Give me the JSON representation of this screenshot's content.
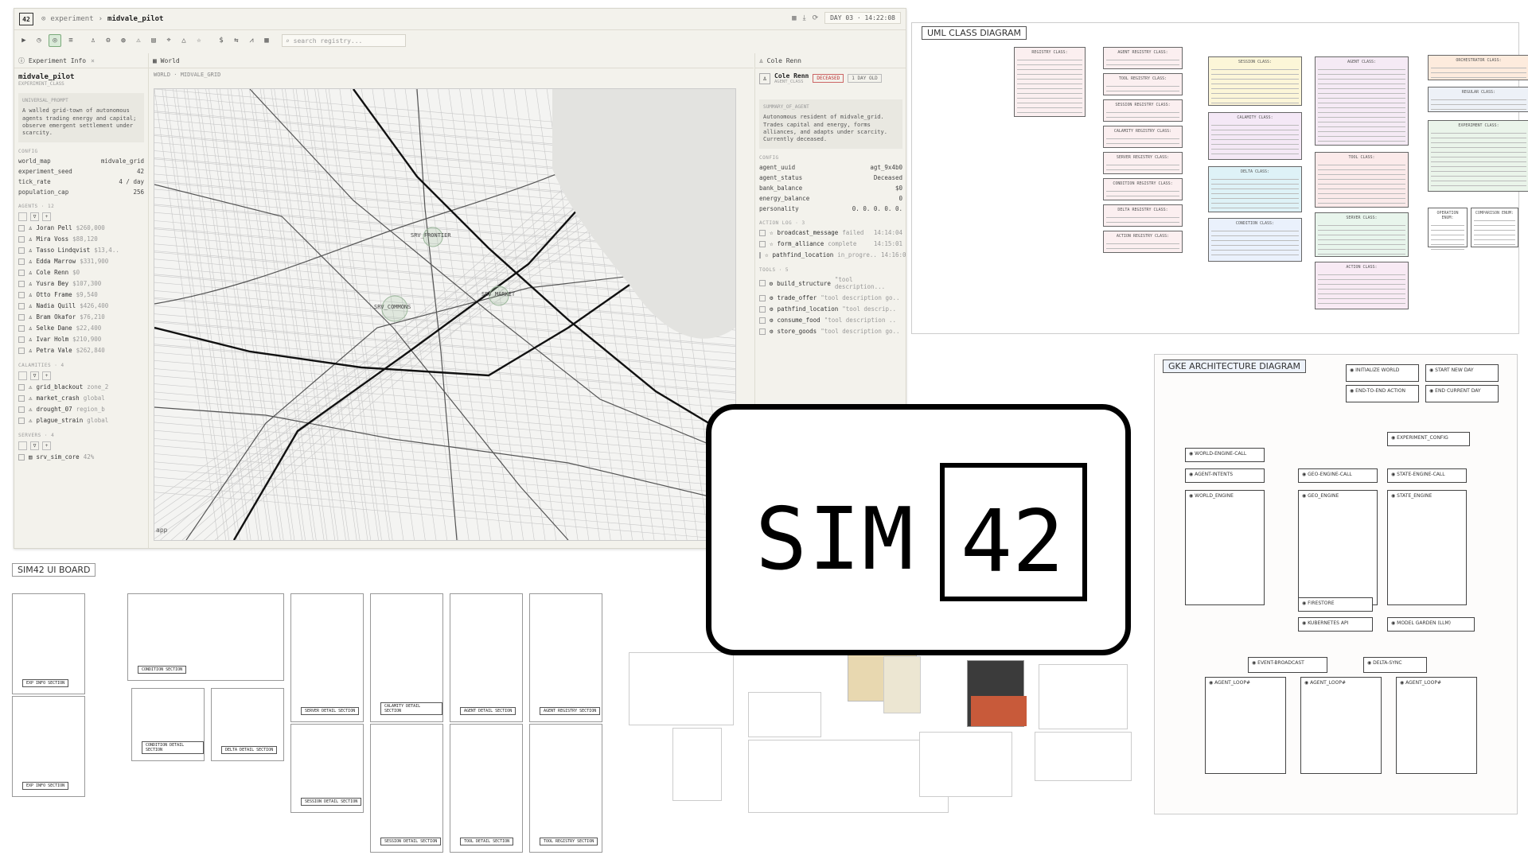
{
  "app": {
    "badge": "42",
    "crumb_root": "experiment",
    "crumb_current": "midvale_pilot",
    "day_label": "DAY 03",
    "time": "14:22:08",
    "search_placeholder": "search registry..."
  },
  "left_panel": {
    "tab": "Experiment Info",
    "title": "midvale_pilot",
    "subtitle": "EXPERIMENT_CLASS",
    "prompt_label": "UNIVERSAL_PROMPT",
    "prompt": "A walled grid-town of autonomous agents trading energy and capital; observe emergent settlement under scarcity.",
    "config_label": "CONFIG",
    "config": [
      {
        "k": "world_map",
        "v": "midvale_grid"
      },
      {
        "k": "experiment_seed",
        "v": "42"
      },
      {
        "k": "tick_rate",
        "v": "4 / day"
      },
      {
        "k": "population_cap",
        "v": "256"
      }
    ],
    "agents_label": "AGENTS · 12",
    "agents": [
      {
        "name": "Joran Pell",
        "val": "$260,000"
      },
      {
        "name": "Mira Voss",
        "val": "$88,120"
      },
      {
        "name": "Tasso Lindqvist",
        "val": "$13,4.."
      },
      {
        "name": "Edda Marrow",
        "val": "$331,900"
      },
      {
        "name": "Cole Renn",
        "val": "$0"
      },
      {
        "name": "Yusra Bey",
        "val": "$107,300"
      },
      {
        "name": "Otto Frame",
        "val": "$9,540"
      },
      {
        "name": "Nadia Quill",
        "val": "$426,400"
      },
      {
        "name": "Bram Okafor",
        "val": "$76,210"
      },
      {
        "name": "Selke Dane",
        "val": "$22,400"
      },
      {
        "name": "Ivar Holm",
        "val": "$210,900"
      },
      {
        "name": "Petra Vale",
        "val": "$262,840"
      }
    ],
    "calamities_label": "CALAMITIES · 4",
    "calamities": [
      {
        "name": "grid_blackout",
        "val": "zone_2"
      },
      {
        "name": "market_crash",
        "val": "global"
      },
      {
        "name": "drought_07",
        "val": "region_b"
      },
      {
        "name": "plague_strain",
        "val": "global"
      }
    ],
    "servers_label": "SERVERS · 4",
    "servers": [
      {
        "name": "srv_sim_core",
        "val": "42%"
      }
    ]
  },
  "world_panel": {
    "tab": "World",
    "breadcrumb": "WORLD · MIDVALE_GRID",
    "markers": [
      "SRV_FRONTIER",
      "SRV_COMMONS",
      "SRV_MARKET"
    ],
    "map_attrib": "app"
  },
  "right_panel": {
    "tab": "Cole Renn",
    "name": "Cole Renn",
    "subtitle": "AGENT_CLASS",
    "status_tag": "DECEASED",
    "age_tag": "1 DAY OLD",
    "summary_label": "SUMMARY_OF_AGENT",
    "summary": "Autonomous resident of midvale_grid. Trades capital and energy, forms alliances, and adapts under scarcity. Currently deceased.",
    "config_label": "CONFIG",
    "config": [
      {
        "k": "agent_uuid",
        "v": "agt_9x4b0"
      },
      {
        "k": "agent_status",
        "v": "Deceased"
      },
      {
        "k": "bank_balance",
        "v": "$0"
      },
      {
        "k": "energy_balance",
        "v": "0"
      },
      {
        "k": "personality",
        "v": "0. 0. 0. 0. 0."
      }
    ],
    "action_label": "ACTION LOG · 3",
    "actions": [
      {
        "name": "broadcast_message",
        "status": "failed",
        "t": "14:14:04"
      },
      {
        "name": "form_alliance",
        "status": "complete",
        "t": "14:15:01"
      },
      {
        "name": "pathfind_location",
        "status": "in_progre..",
        "t": "14:16:09"
      }
    ],
    "tools_label": "TOOLS · 5",
    "tools": [
      {
        "name": "build_structure",
        "desc": "\"tool description..."
      },
      {
        "name": "trade_offer",
        "desc": "\"tool description go.."
      },
      {
        "name": "pathfind_location",
        "desc": "\"tool descrip.."
      },
      {
        "name": "consume_food",
        "desc": "\"tool description .."
      },
      {
        "name": "store_goods",
        "desc": "\"tool description go.."
      }
    ]
  },
  "logo": {
    "left": "SIM",
    "right": "42"
  },
  "boards": {
    "uml_title": "UML CLASS DIAGRAM",
    "gke_title": "GKE ARCHITECTURE DIAGRAM",
    "ui_title": "SIM42 UI BOARD",
    "gke_legend": [
      "INITIALIZE WORLD",
      "START NEW DAY",
      "END-TO-END ACTION",
      "END CURRENT DAY"
    ],
    "gke_nodes": [
      "EXPERIMENT_CONFIG",
      "WORLD-ENGINE-CALL",
      "AGENT-INTENTS",
      "WORLD_ENGINE",
      "GEO-ENGINE-CALL",
      "GEO_ENGINE",
      "STATE-ENGINE-CALL",
      "STATE_ENGINE",
      "FIRESTORE",
      "KUBERNETES API",
      "MODEL GARDEN (LLM)",
      "EVENT-BROADCAST",
      "DELTA-SYNC",
      "AGENT_LOOP#",
      "AGENT_LOOP#",
      "AGENT_LOOP#"
    ],
    "uml_left": [
      "REGISTRY CLASS:",
      "AGENT REGISTRY CLASS:",
      "TOOL REGISTRY CLASS:",
      "SESSION REGISTRY CLASS:",
      "CALAMITY REGISTRY CLASS:",
      "SERVER REGISTRY CLASS:",
      "CONDITION REGISTRY CLASS:",
      "DELTA REGISTRY CLASS:",
      "ACTION REGISTRY CLASS:"
    ],
    "uml_mid": [
      "SESSION CLASS:",
      "CALAMITY CLASS:",
      "DELTA CLASS:",
      "CONDITION CLASS:"
    ],
    "uml_mid2": [
      "AGENT CLASS:",
      "TOOL CLASS:",
      "SERVER CLASS:",
      "ACTION CLASS:"
    ],
    "uml_right": [
      "ORCHESTRATOR CLASS:",
      "REGULAR CLASS:",
      "EXPERIMENT CLASS:",
      "OPERATION ENUM:",
      "COMPARISON ENUM:"
    ],
    "ui_cards": [
      "EXP INFO SECTION",
      "CONDITION SECTION",
      "SERVER DETAIL SECTION",
      "CALAMITY DETAIL SECTION",
      "AGENT DETAIL SECTION",
      "AGENT REGISTRY SECTION",
      "EXP INFO SECTION",
      "CONDITION DETAIL SECTION",
      "DELTA DETAIL SECTION",
      "SESSION DETAIL SECTION",
      "SESSION DETAIL SECTION",
      "TOOL DETAIL SECTION",
      "TOOL REGISTRY SECTION"
    ]
  },
  "colors": {
    "accent_green": "#7aaa7a",
    "deceased_red": "#b33333",
    "logo": "#000000"
  }
}
